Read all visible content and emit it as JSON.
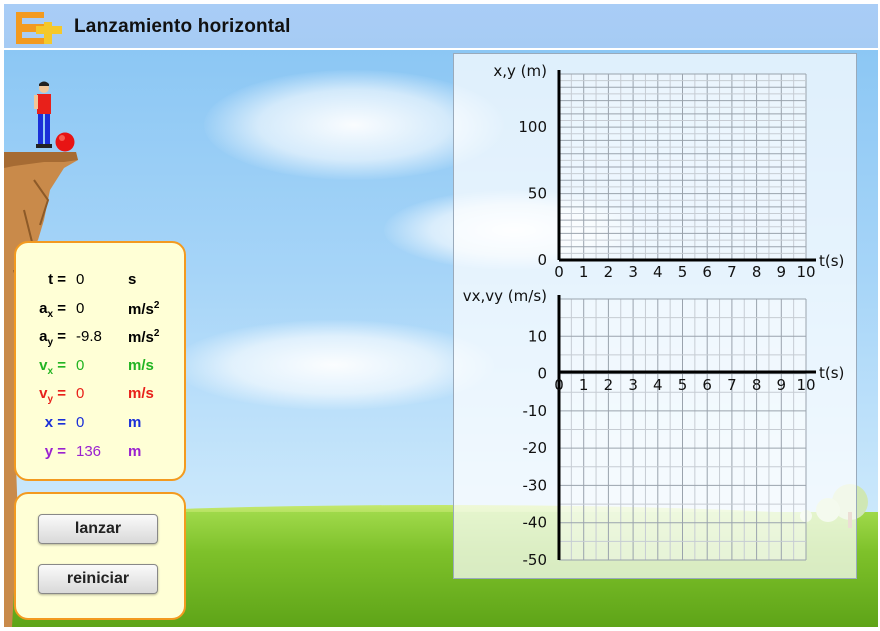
{
  "header": {
    "title": "Lanzamiento horizontal",
    "logo_colors": {
      "orange": "#f39a1f",
      "yellow": "#f5c82a"
    }
  },
  "info": {
    "rows": [
      {
        "label": "t",
        "sub": "",
        "value": "0",
        "unit": "s",
        "unit_sup": "",
        "color": "#000000"
      },
      {
        "label": "a",
        "sub": "x",
        "value": "0",
        "unit": "m/s",
        "unit_sup": "2",
        "color": "#000000"
      },
      {
        "label": "a",
        "sub": "y",
        "value": "-9.8",
        "unit": "m/s",
        "unit_sup": "2",
        "color": "#000000"
      },
      {
        "label": "v",
        "sub": "x",
        "value": "0",
        "unit": "m/s",
        "unit_sup": "",
        "color": "#22b422"
      },
      {
        "label": "v",
        "sub": "y",
        "value": "0",
        "unit": "m/s",
        "unit_sup": "",
        "color": "#e8201a"
      },
      {
        "label": "x",
        "sub": "",
        "value": "0",
        "unit": "m",
        "unit_sup": "",
        "color": "#1a2fd8"
      },
      {
        "label": "y",
        "sub": "",
        "value": "136",
        "unit": "m",
        "unit_sup": "",
        "color": "#9a22d0"
      }
    ]
  },
  "controls": {
    "launch_label": "lanzar",
    "reset_label": "reiniciar"
  },
  "chart_data": [
    {
      "type": "line",
      "ylabel": "x,y (m)",
      "xlabel": "t(s)",
      "xlim": [
        0,
        10
      ],
      "ylim": [
        0,
        140
      ],
      "x_ticks": [
        "0",
        "1",
        "2",
        "3",
        "4",
        "5",
        "6",
        "7",
        "8",
        "9",
        "10"
      ],
      "y_ticks": [
        "0",
        "50",
        "100"
      ],
      "grid": true,
      "series": []
    },
    {
      "type": "line",
      "ylabel": "vx,vy (m/s)",
      "xlabel": "t(s)",
      "xlim": [
        0,
        10
      ],
      "ylim": [
        -50,
        20
      ],
      "x_ticks": [
        "0",
        "1",
        "2",
        "3",
        "4",
        "5",
        "6",
        "7",
        "8",
        "9",
        "10"
      ],
      "y_ticks": [
        "10",
        "0",
        "-10",
        "-20",
        "-30",
        "-40",
        "-50"
      ],
      "grid": true,
      "series": []
    }
  ]
}
